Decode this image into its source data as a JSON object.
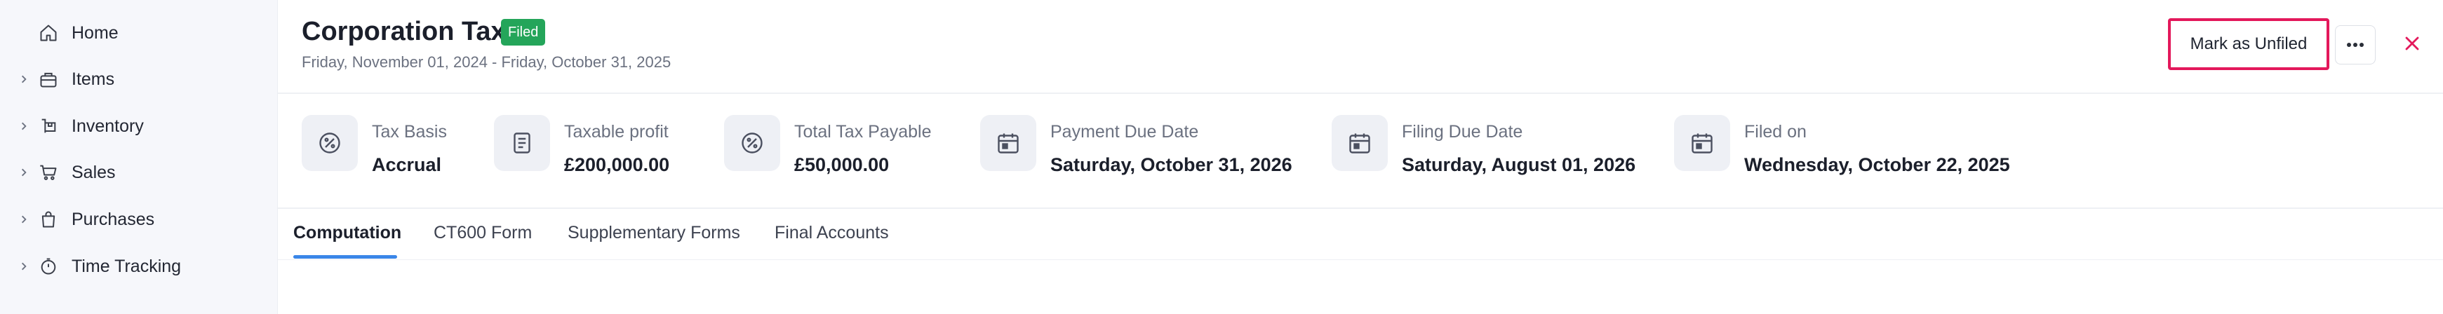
{
  "sidebar": {
    "items": [
      {
        "label": "Home",
        "icon": "home-icon",
        "expandable": false
      },
      {
        "label": "Items",
        "icon": "items-icon",
        "expandable": true
      },
      {
        "label": "Inventory",
        "icon": "inventory-icon",
        "expandable": true
      },
      {
        "label": "Sales",
        "icon": "cart-icon",
        "expandable": true
      },
      {
        "label": "Purchases",
        "icon": "bag-icon",
        "expandable": true
      },
      {
        "label": "Time Tracking",
        "icon": "stopwatch-icon",
        "expandable": true
      }
    ]
  },
  "header": {
    "title": "Corporation Tax",
    "status_badge": "Filed",
    "period": "Friday, November 01, 2024 - Friday, October 31, 2025",
    "mark_unfiled_label": "Mark as Unfiled",
    "more_icon": "more-horizontal-icon",
    "close_icon": "close-icon"
  },
  "stats": [
    {
      "label": "Tax Basis",
      "value": "Accrual",
      "icon": "percent-icon"
    },
    {
      "label": "Taxable profit",
      "value": "£200,000.00",
      "icon": "document-icon"
    },
    {
      "label": "Total Tax Payable",
      "value": "£50,000.00",
      "icon": "percent-icon"
    },
    {
      "label": "Payment Due Date",
      "value": "Saturday, October 31, 2026",
      "icon": "calendar-icon"
    },
    {
      "label": "Filing Due Date",
      "value": "Saturday, August 01, 2026",
      "icon": "calendar-icon"
    },
    {
      "label": "Filed on",
      "value": "Wednesday, October 22, 2025",
      "icon": "calendar-icon"
    }
  ],
  "tabs": [
    {
      "label": "Computation",
      "active": true
    },
    {
      "label": "CT600 Form",
      "active": false
    },
    {
      "label": "Supplementary Forms",
      "active": false
    },
    {
      "label": "Final Accounts",
      "active": false
    }
  ],
  "colors": {
    "status_green": "#24a55a",
    "accent_red": "#e3185b",
    "tab_blue": "#3a86e8"
  }
}
